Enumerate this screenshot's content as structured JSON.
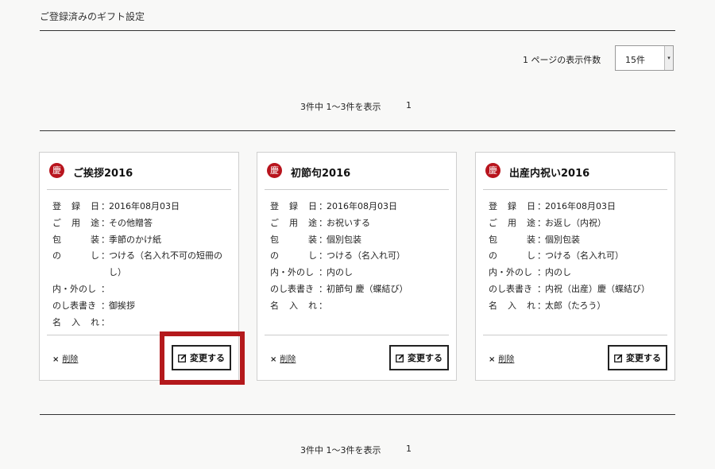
{
  "page": {
    "title": "ご登録済みのギフト設定",
    "per_page_label": "1 ページの表示件数",
    "per_page_value": "15件",
    "pager_count": "3件中 1〜3件を表示",
    "pager_page": "1"
  },
  "card_seal": "慶",
  "delete_label": "削除",
  "delete_icon": "×",
  "edit_label": "変更する",
  "field_labels": {
    "registered": [
      "登",
      "録",
      "日"
    ],
    "purpose": [
      "ご",
      "用",
      "途"
    ],
    "wrapping": [
      "包",
      "装"
    ],
    "noshi": [
      "の",
      "し"
    ],
    "inner_outer": [
      "内・外のし"
    ],
    "inscription": [
      "のし表書き"
    ],
    "name": [
      "名",
      "入",
      "れ"
    ]
  },
  "colon": "：",
  "cards": [
    {
      "title": "ご挨拶2016",
      "registered": "2016年08月03日",
      "purpose": "その他贈答",
      "wrapping": "季節のかけ紙",
      "noshi": "つける（名入れ不可の短冊のし）",
      "inner_outer": "",
      "inscription": "御挨拶",
      "name": ""
    },
    {
      "title": "初節句2016",
      "registered": "2016年08月03日",
      "purpose": "お祝いする",
      "wrapping": "個別包装",
      "noshi": "つける（名入れ可）",
      "inner_outer": "内のし",
      "inscription": "初節句 慶（蝶結び）",
      "name": ""
    },
    {
      "title": "出産内祝い2016",
      "registered": "2016年08月03日",
      "purpose": "お返し（内祝）",
      "wrapping": "個別包装",
      "noshi": "つける（名入れ可）",
      "inner_outer": "内のし",
      "inscription": "内祝（出産）慶（蝶結び）",
      "name": "太郎（たろう）"
    }
  ],
  "colors": {
    "accent": "#b8141d",
    "highlight": "#b4191c"
  }
}
